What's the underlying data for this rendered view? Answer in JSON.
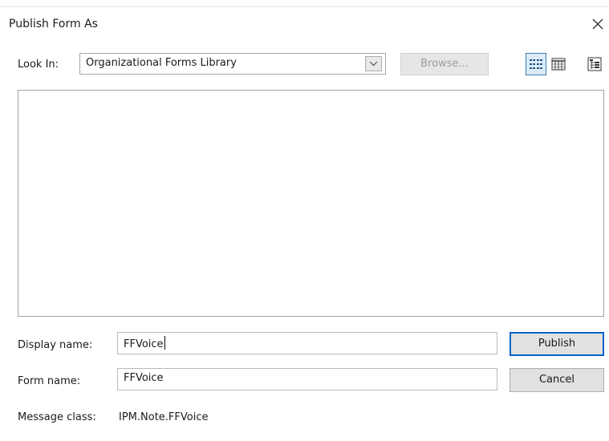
{
  "dialog": {
    "title": "Publish Form As"
  },
  "lookin": {
    "label": "Look In:",
    "value": "Organizational Forms Library",
    "browse_label": "Browse..."
  },
  "view_buttons": [
    {
      "name": "list-view-icon",
      "active": true
    },
    {
      "name": "details-view-icon",
      "active": false
    },
    {
      "name": "tree-view-icon",
      "active": false
    }
  ],
  "fields": {
    "display_name": {
      "label": "Display name:",
      "value": "FFVoice"
    },
    "form_name": {
      "label": "Form name:",
      "value": "FFVoice"
    },
    "message_class": {
      "label": "Message class:",
      "value": "IPM.Note.FFVoice"
    }
  },
  "buttons": {
    "publish": "Publish",
    "cancel": "Cancel"
  },
  "colors": {
    "default_button_border": "#0a63c9",
    "active_view_bg": "#dbeaf7",
    "active_view_border": "#3c7fb1"
  }
}
